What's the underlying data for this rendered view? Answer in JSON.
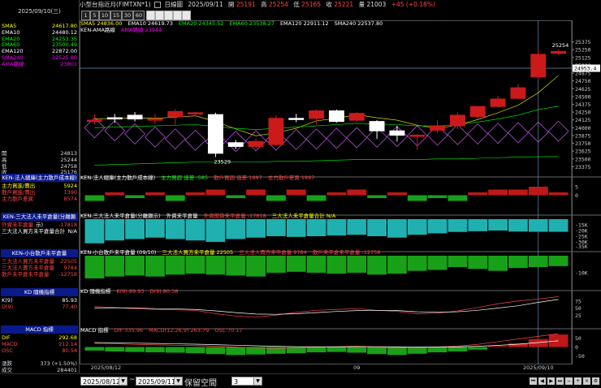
{
  "title_bar": {
    "instrument": "小型台指近月(FIMTXN*1)",
    "period": "日線圖",
    "date": "2025/09/11",
    "open_label": "開",
    "open": "25191",
    "high_label": "高",
    "high": "25254",
    "low_label": "低",
    "low": "25165",
    "close_label": "收",
    "close": "25221",
    "volume_label": "量",
    "volume": "21003",
    "change": "+45 (+0.18%)"
  },
  "toolbar": {
    "buttons": [
      "1",
      "5",
      "10",
      "15",
      "30",
      "60"
    ],
    "selected_date": "2025/09/10(三)"
  },
  "left_panel": {
    "ma_rows": [
      {
        "label": "SMA5",
        "value": "24617.80",
        "color": "#ffff00"
      },
      {
        "label": "EMA10",
        "value": "24480.12",
        "color": "#ffffff"
      },
      {
        "label": "EMA20",
        "value": "24253.35",
        "color": "#00ff00"
      },
      {
        "label": "EMA60",
        "value": "23500.49",
        "color": "#00ff00"
      },
      {
        "label": "EMA120",
        "value": "22872.00",
        "color": "#ffffff"
      },
      {
        "label": "SMA240",
        "value": "22525.80",
        "color": "#ff00ff"
      },
      {
        "label": "AMA路線",
        "value": "23801",
        "color": "#ff00ff"
      }
    ],
    "ohlc_rows": [
      {
        "label": "開",
        "value": "24813"
      },
      {
        "label": "高",
        "value": "25244"
      },
      {
        "label": "低",
        "value": "24758"
      },
      {
        "label": "收",
        "value": "25176"
      }
    ],
    "sections": [
      {
        "title": "KEN-法人總庫(主力散戶成本線)",
        "rows": [
          {
            "label": "主力買進/賣出",
            "value": "5924",
            "color": "#ffff00"
          },
          {
            "label": "散戶買進/賣出",
            "value": "1390",
            "color": "#ff4444"
          },
          {
            "label": "主力散戶差異",
            "value": "8574",
            "color": "#ff4444"
          }
        ]
      },
      {
        "title": "KEN-三大法人未平倉量(分離顯示)",
        "rows": [
          {
            "label": "外資未平倉量",
            "value": "-17818",
            "color": "#ff4444"
          },
          {
            "label": "三大法人買方未平倉量合計",
            "value": "N/A",
            "color": "#ffffff"
          }
        ]
      },
      {
        "title": "KEN-小台散戶未平倉量",
        "rows": [
          {
            "label": "三大法人買方未平倉量",
            "value": "22505",
            "color": "#ff4444"
          },
          {
            "label": "三大法人賣方未平倉量",
            "value": "9784",
            "color": "#ff4444"
          },
          {
            "label": "散戶未平倉未平倉量",
            "value": "-12758",
            "color": "#ff4444"
          }
        ]
      },
      {
        "title": "KD 隨機指標",
        "rows": [
          {
            "label": "K(9)",
            "value": "85.93",
            "color": "#ffffff"
          },
          {
            "label": "D(9)",
            "value": "77.40",
            "color": "#ff4444"
          }
        ]
      },
      {
        "title": "MACD 指標",
        "rows": [
          {
            "label": "DIF",
            "value": "292.68",
            "color": "#ffff00"
          },
          {
            "label": "MACD",
            "value": "212.14",
            "color": "#ff4444"
          },
          {
            "label": "OSC",
            "value": "80.54",
            "color": "#ff4444"
          }
        ]
      }
    ],
    "footer_rows": [
      {
        "label": "漲跌",
        "value": "373 (+1.50%)"
      },
      {
        "label": "成交",
        "value": "284401"
      }
    ]
  },
  "legends": {
    "main": [
      {
        "text": "SMA5 24836.00",
        "color": "#ffff00"
      },
      {
        "text": "EMA10 24619.73",
        "color": "#ffffff"
      },
      {
        "text": "EMA20 24345.52",
        "color": "#00ff00"
      },
      {
        "text": "EMA60 23538.27",
        "color": "#00ff00"
      },
      {
        "text": "EMA120 22911.12",
        "color": "#ffffff"
      },
      {
        "text": "SMA240 22537.80",
        "color": "#ffffff"
      }
    ],
    "main2": [
      {
        "text": "KEN-AMA路線",
        "color": "#ffffff"
      },
      {
        "text": "AMA路線 23944",
        "color": "#ff00ff"
      }
    ],
    "p1": [
      {
        "text": "KEN-法人總庫(主力散戶成本線)",
        "color": "#ffffff"
      },
      {
        "text": "主力買超 值差 -585",
        "color": "#00ff00"
      },
      {
        "text": "散戶買超 值差 1997",
        "color": "#ff4444"
      },
      {
        "text": "主力散戶差異 1997",
        "color": "#ff4444"
      }
    ],
    "p2": [
      {
        "text": "KEN-三大法人未平倉量(分離顯示)",
        "color": "#ffffff"
      },
      {
        "text": "外資未平倉量",
        "color": "#ffffff"
      },
      {
        "text": "外資期貨未平倉量 -17818",
        "color": "#ff4444"
      },
      {
        "text": "三大法人未平倉量合計 N/A",
        "color": "#ffff00"
      }
    ],
    "p3": [
      {
        "text": "KEN-小台散戶未平倉量 (09/10)",
        "color": "#ffffff"
      },
      {
        "text": "三大法人買方未平倉量 22505",
        "color": "#ffff00"
      },
      {
        "text": "三大法人賣方未平倉量 9784",
        "color": "#ff4444"
      },
      {
        "text": "散戶未平倉未平倉量 -12758",
        "color": "#ff4444"
      }
    ],
    "p4": [
      {
        "text": "KD 隨機指標",
        "color": "#ffffff"
      },
      {
        "text": "K(9) 89.93",
        "color": "#ff4444"
      },
      {
        "text": "D(9) 80.38",
        "color": "#ff4444"
      }
    ],
    "p5": [
      {
        "text": "MACD 指標",
        "color": "#ffffff"
      },
      {
        "text": "DIF 335.96",
        "color": "#ff4444"
      },
      {
        "text": "MACD(12,26,9) 263.79",
        "color": "#ff4444"
      },
      {
        "text": "OSC 70.17",
        "color": "#ff4444"
      }
    ]
  },
  "annotations": {
    "high_mark": "25254",
    "low_mark": "23529",
    "price_tag": "24953.4"
  },
  "x_axis": {
    "labels": [
      "2025/08/12",
      "09",
      "2025/09/10"
    ]
  },
  "bottom_bar": {
    "start_date": "2025/08/12",
    "end_date": "2025/09/11",
    "separator": "~",
    "reserve_label": "保留空間",
    "reserve_value": "3"
  },
  "nav_icons": [
    "first-icon",
    "prev-icon",
    "next-icon",
    "last-icon",
    "zoom-out-icon",
    "zoom-in-icon",
    "close-icon",
    "settings-icon"
  ],
  "chart_data": [
    {
      "type": "candlestick",
      "title": "小型台指近月(FIMTXN*1) 日線圖",
      "ylim": [
        23250,
        25500
      ],
      "y_ticks": [
        23375,
        23500,
        23625,
        23750,
        23875,
        24000,
        24125,
        24250,
        24375,
        24500,
        24625,
        24750,
        24875,
        25000,
        25125,
        25250,
        25375
      ],
      "candles": [
        {
          "o": 24120,
          "h": 24220,
          "l": 24050,
          "c": 24120
        },
        {
          "o": 24160,
          "h": 24220,
          "l": 24080,
          "c": 24140
        },
        {
          "o": 24200,
          "h": 24250,
          "l": 24100,
          "c": 24140
        },
        {
          "o": 24140,
          "h": 24220,
          "l": 24060,
          "c": 24140
        },
        {
          "o": 24180,
          "h": 24300,
          "l": 24050,
          "c": 24260
        },
        {
          "o": 24240,
          "h": 24260,
          "l": 24180,
          "c": 24240
        },
        {
          "o": 24210,
          "h": 24240,
          "l": 23529,
          "c": 23590
        },
        {
          "o": 23760,
          "h": 23800,
          "l": 23660,
          "c": 23700
        },
        {
          "o": 23700,
          "h": 23830,
          "l": 23670,
          "c": 23780
        },
        {
          "o": 23730,
          "h": 24200,
          "l": 23700,
          "c": 24150
        },
        {
          "o": 24150,
          "h": 24220,
          "l": 24090,
          "c": 24140
        },
        {
          "o": 24150,
          "h": 24290,
          "l": 24050,
          "c": 24270
        },
        {
          "o": 24270,
          "h": 24290,
          "l": 24080,
          "c": 24100
        },
        {
          "o": 24120,
          "h": 24250,
          "l": 24100,
          "c": 24230
        },
        {
          "o": 24100,
          "h": 24120,
          "l": 23820,
          "c": 23950
        },
        {
          "o": 23950,
          "h": 24030,
          "l": 23780,
          "c": 23880
        },
        {
          "o": 23870,
          "h": 23900,
          "l": 23640,
          "c": 23880
        },
        {
          "o": 23960,
          "h": 24120,
          "l": 23920,
          "c": 24030
        },
        {
          "o": 24030,
          "h": 24250,
          "l": 23980,
          "c": 24200
        },
        {
          "o": 24180,
          "h": 24350,
          "l": 24150,
          "c": 24340
        },
        {
          "o": 24340,
          "h": 24510,
          "l": 24330,
          "c": 24460
        },
        {
          "o": 24470,
          "h": 24700,
          "l": 24460,
          "c": 24640
        },
        {
          "o": 24813,
          "h": 25244,
          "l": 24758,
          "c": 25176
        },
        {
          "o": 25191,
          "h": 25254,
          "l": 25165,
          "c": 25221
        }
      ],
      "ma_lines": [
        {
          "name": "SMA5",
          "color": "#ffff00",
          "values": [
            24140,
            24150,
            24160,
            24150,
            24170,
            24190,
            24100,
            23980,
            23870,
            23920,
            23990,
            24110,
            24150,
            24210,
            24160,
            24120,
            24040,
            23990,
            24040,
            24130,
            24240,
            24360,
            24560,
            24836
          ]
        },
        {
          "name": "EMA20",
          "color": "#00ff00",
          "values": [
            24000,
            24010,
            24020,
            24030,
            24040,
            24050,
            24020,
            23990,
            23970,
            23990,
            24010,
            24030,
            24050,
            24070,
            24060,
            24050,
            24030,
            24030,
            24050,
            24090,
            24140,
            24200,
            24290,
            24345
          ]
        },
        {
          "name": "EMA60",
          "color": "#00ff00",
          "values": [
            23400,
            23410,
            23420,
            23430,
            23440,
            23450,
            23450,
            23450,
            23450,
            23460,
            23460,
            23470,
            23480,
            23490,
            23490,
            23490,
            23490,
            23500,
            23500,
            23510,
            23520,
            23530,
            23535,
            23538
          ]
        }
      ],
      "ama_diamonds": [
        24000,
        23950,
        23900,
        23850,
        23820,
        23800,
        23780,
        23780,
        23790,
        23800,
        23810,
        23820,
        23830,
        23840,
        23850,
        23860,
        23870,
        23880,
        23890,
        23900,
        23910,
        23920,
        23930,
        23944
      ]
    },
    {
      "type": "bar",
      "title": "KEN-法人總庫(主力散戶成本線)",
      "ylim": [
        -5,
        5
      ],
      "values": [
        -2,
        1,
        -1,
        1,
        -2,
        1,
        2,
        -1,
        2,
        -2,
        2,
        -2,
        1,
        2,
        -1,
        1,
        -2,
        -1,
        -2,
        1,
        2,
        2,
        3,
        1
      ]
    },
    {
      "type": "bar",
      "title": "KEN-三大法人未平倉量(分離顯示)",
      "ylim": [
        -40000,
        0
      ],
      "values": [
        -34000,
        -30000,
        -28000,
        -26000,
        -28000,
        -30000,
        -32000,
        -28000,
        -26000,
        -24000,
        -25000,
        -24000,
        -23000,
        -22000,
        -24000,
        -26000,
        -22000,
        -20000,
        -18000,
        -17000,
        -16000,
        -17500,
        -17800,
        -17818
      ]
    },
    {
      "type": "bar",
      "title": "KEN-小台散戶未平倉量",
      "ylim": [
        -15000,
        0
      ],
      "values": [
        -12000,
        -11000,
        -10500,
        -11000,
        -10000,
        -9500,
        -10000,
        -10500,
        -11000,
        -9000,
        -8500,
        -9000,
        -9500,
        -9000,
        -10000,
        -9500,
        -8000,
        -7500,
        -6000,
        -7000,
        -8000,
        -6500,
        -6000,
        -5500
      ]
    },
    {
      "type": "line",
      "title": "KD 隨機指標",
      "ylim": [
        0,
        100
      ],
      "series": [
        {
          "name": "K(9)",
          "color": "#ff4444",
          "values": [
            55,
            52,
            48,
            45,
            44,
            42,
            30,
            22,
            18,
            25,
            35,
            42,
            45,
            48,
            42,
            38,
            30,
            32,
            40,
            52,
            65,
            75,
            82,
            89.93
          ]
        },
        {
          "name": "D(9)",
          "color": "#ffffff",
          "values": [
            50,
            51,
            50,
            48,
            47,
            45,
            40,
            34,
            29,
            28,
            30,
            34,
            38,
            41,
            42,
            41,
            37,
            35,
            37,
            42,
            50,
            58,
            70,
            80.38
          ]
        }
      ]
    },
    {
      "type": "bar",
      "title": "MACD 指標",
      "ylim": [
        -80,
        80
      ],
      "values": [
        -20,
        -25,
        -28,
        -30,
        -32,
        -35,
        -40,
        -45,
        -42,
        -38,
        -35,
        -30,
        -28,
        -32,
        -40,
        -45,
        -38,
        -30,
        -25,
        -15,
        5,
        20,
        45,
        70.17
      ],
      "series": [
        {
          "name": "DIF",
          "color": "#ff4444",
          "values": [
            20,
            18,
            15,
            12,
            10,
            8,
            5,
            0,
            -5,
            -8,
            -5,
            0,
            2,
            5,
            0,
            -5,
            -5,
            0,
            5,
            15,
            30,
            45,
            60,
            75
          ]
        },
        {
          "name": "MACD",
          "color": "#ffffff",
          "values": [
            25,
            24,
            22,
            20,
            18,
            16,
            13,
            10,
            7,
            4,
            2,
            1,
            1,
            2,
            2,
            1,
            0,
            0,
            1,
            4,
            9,
            16,
            25,
            35
          ]
        }
      ]
    }
  ]
}
